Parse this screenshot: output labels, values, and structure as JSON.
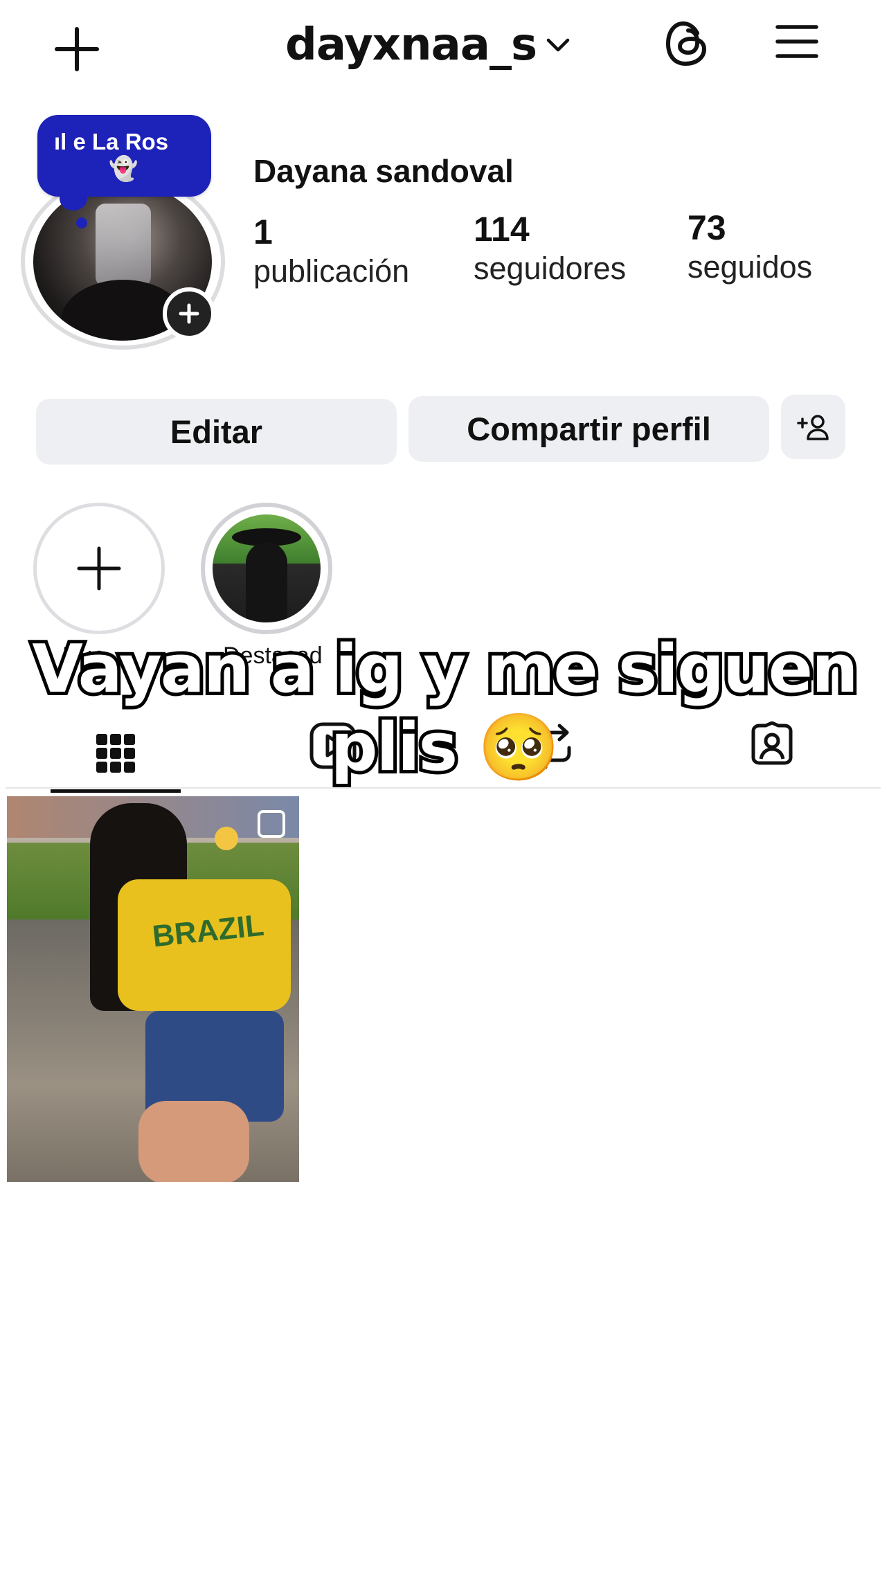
{
  "header": {
    "username": "dayxnaa_s",
    "icons": [
      "plus-icon",
      "chevron-down-icon",
      "threads-icon",
      "menu-icon"
    ]
  },
  "note": {
    "text": "ıl  e La Ros",
    "emoji": "👻"
  },
  "profile": {
    "display_name": "Dayana sandoval",
    "stats": [
      {
        "value": "1",
        "label": "publicación"
      },
      {
        "value": "114",
        "label": "seguidores"
      },
      {
        "value": "73",
        "label": "seguidos"
      }
    ]
  },
  "actions": {
    "edit_label": "Editar",
    "share_label": "Compartir perfil"
  },
  "highlights": [
    {
      "label": "Nue"
    },
    {
      "label": "Destacad"
    }
  ],
  "tabs": [
    "grid-icon",
    "reels-icon",
    "reposts-icon",
    "tagged-icon"
  ],
  "overlay_caption": {
    "line1": "Vayan a ig y me siguen",
    "line2": "plis 🥺"
  },
  "posts": [
    {
      "jersey_text": "BRAZIL"
    }
  ],
  "colors": {
    "note_bubble": "#1d22b8",
    "button_bg": "#eeeff2",
    "text": "#111111"
  }
}
